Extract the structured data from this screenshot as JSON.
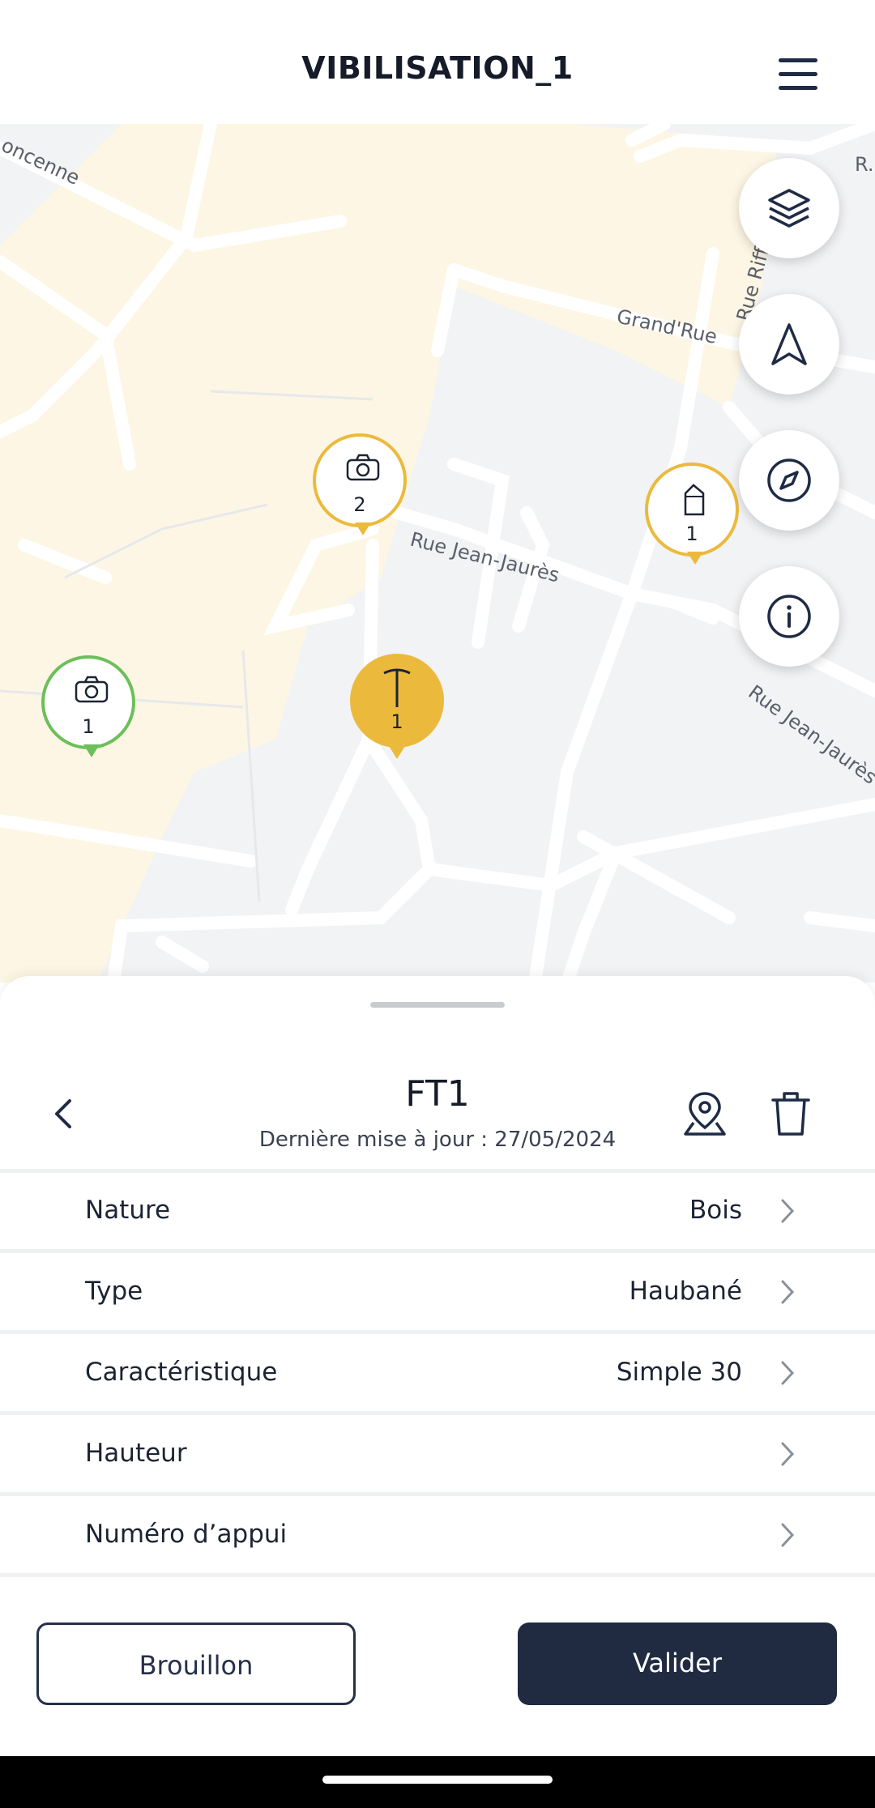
{
  "header": {
    "title": "VIBILISATION_1",
    "menu_icon": "hamburger-menu-icon"
  },
  "map": {
    "street_labels": [
      "Rue Jean-Jaurès",
      "Grand'Rue",
      "Rue Riff",
      "Rue Jean-Jaurès",
      "oncenne",
      "R."
    ],
    "controls": [
      "layers-icon",
      "navigation-arrow-icon",
      "compass-icon",
      "info-icon"
    ],
    "markers": [
      {
        "icon": "camera-icon",
        "count": "2",
        "color": "#ebba3d"
      },
      {
        "icon": "building-icon",
        "count": "1",
        "color": "#ebba3d"
      },
      {
        "icon": "camera-icon",
        "count": "1",
        "color": "#6cbf5a"
      },
      {
        "icon": "pole-icon",
        "count": "1",
        "color": "#ebba3d"
      }
    ]
  },
  "sheet": {
    "title": "FT1",
    "subtitle": "Dernière mise à jour : 27/05/2024",
    "rows": [
      {
        "label": "Nature",
        "value": "Bois"
      },
      {
        "label": "Type",
        "value": "Haubané"
      },
      {
        "label": "Caractéristique",
        "value": "Simple 30"
      },
      {
        "label": "Hauteur",
        "value": ""
      },
      {
        "label": "Numéro d’appui",
        "value": ""
      }
    ],
    "draft_label": "Brouillon",
    "validate_label": "Valider"
  },
  "colors": {
    "accent": "#ebba3d",
    "green": "#6cbf5a",
    "primary": "#202b42"
  }
}
